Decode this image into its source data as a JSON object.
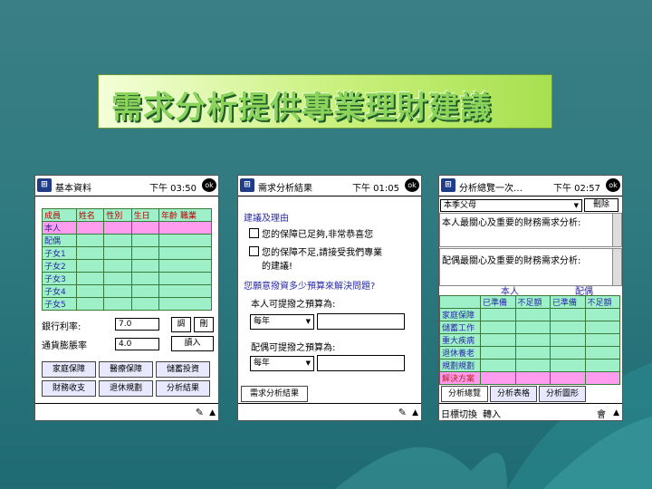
{
  "slide_title": "需求分析提供專業理財建議",
  "screen1": {
    "title": "基本資料",
    "time": "下午 03:50",
    "ok": "ok",
    "table_headers": [
      "成員",
      "姓名",
      "性別",
      "生日",
      "年齡",
      "職業"
    ],
    "rows": [
      "本人",
      "配偶",
      "子女1",
      "子女2",
      "子女3",
      "子女4",
      "子女5"
    ],
    "bank_rate_label": "銀行利率:",
    "bank_rate_value": "7.0",
    "inflation_label": "通貨膨脹率",
    "inflation_value": "4.0",
    "btn_adjust": "調",
    "btn_delete": "刪",
    "btn_enter": "讀入",
    "buttons": [
      "家庭保障",
      "醫療保障",
      "儲蓄投資",
      "財務收支",
      "退休規劃",
      "分析結果"
    ]
  },
  "screen2": {
    "title": "需求分析結果",
    "time": "下午 01:05",
    "ok": "ok",
    "advice_heading": "建議及理由",
    "option1": "您的保障已足夠,非常恭喜您",
    "option2_line1": "您的保障不足,請接受我們專業",
    "option2_line2": "的建議!",
    "question": "您願意撥資多少預算來解決問題?",
    "self_label": "本人可提撥之預算為:",
    "self_select": "每年",
    "spouse_label": "配偶可提撥之預算為:",
    "spouse_select": "每年",
    "tab": "需求分析結果"
  },
  "screen3": {
    "title": "分析總覽一次…",
    "time": "下午 02:57",
    "ok": "ok",
    "selector": "本季父母",
    "delete_btn": "刪除",
    "q1": "本人最關心及重要的財務需求分析:",
    "q2": "配偶最關心及重要的財務需求分析:",
    "col_self": "本人",
    "col_spouse": "配偶",
    "sub_headers": [
      "已準備",
      "不足額",
      "已準備",
      "不足額"
    ],
    "rows": [
      "家庭保障",
      "儲蓄工作",
      "重大疾病",
      "退休養老",
      "規劃規劃",
      "解決方案"
    ],
    "tabs": [
      "分析總覽",
      "分析表格",
      "分析圖形"
    ],
    "bottom_left": "日標切換",
    "bottom_mid": "轉入",
    "bottom_right": "會"
  },
  "colors": {
    "accent_green": "#9ef0c8",
    "highlight_pink": "#ff9cf0",
    "title_blue": "#2a2aa8"
  }
}
